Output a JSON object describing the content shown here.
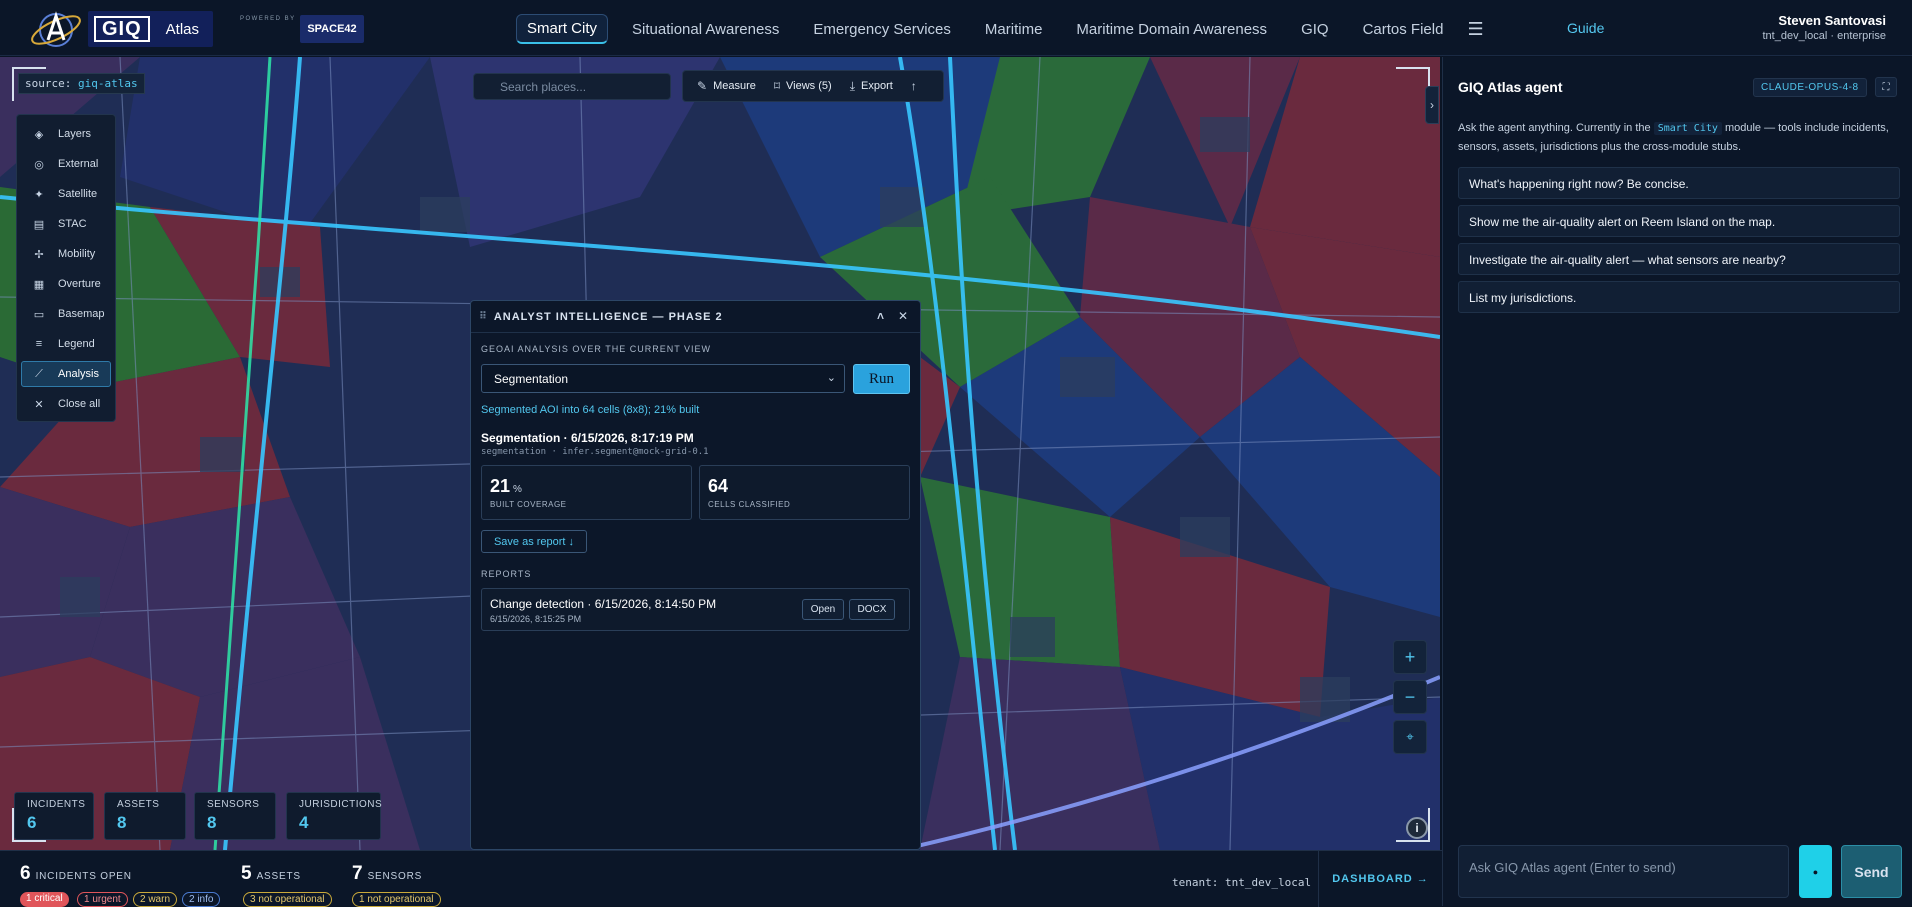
{
  "header": {
    "logo_giq": "GIQ",
    "logo_atlas": "Atlas",
    "powered_by": "POWERED BY",
    "partner": "SPACE42",
    "nav": [
      "Smart City",
      "Situational Awareness",
      "Emergency Services",
      "Maritime",
      "Maritime Domain Awareness",
      "GIQ",
      "Cartos Field"
    ],
    "active_nav": "Smart City",
    "menu_icon": "hamburger-icon",
    "guide": "Guide",
    "user_name": "Steven Santovasi",
    "user_tenant": "tnt_dev_local · enterprise"
  },
  "map": {
    "source_label": "source:",
    "source_value": "giq-atlas",
    "search_placeholder": "Search places...",
    "tools": {
      "measure": "Measure",
      "views": "Views (5)",
      "export": "Export"
    },
    "sidebar": [
      {
        "label": "Layers",
        "icon": "layers-icon"
      },
      {
        "label": "External",
        "icon": "globe-icon"
      },
      {
        "label": "Satellite",
        "icon": "satellite-icon"
      },
      {
        "label": "STAC",
        "icon": "stack-icon"
      },
      {
        "label": "Mobility",
        "icon": "mobility-icon"
      },
      {
        "label": "Overture",
        "icon": "grid-icon"
      },
      {
        "label": "Basemap",
        "icon": "map-icon"
      },
      {
        "label": "Legend",
        "icon": "list-icon"
      },
      {
        "label": "Analysis",
        "icon": "chart-icon"
      },
      {
        "label": "Close all",
        "icon": "close-icon"
      }
    ],
    "active_sidebar": "Analysis",
    "stats": [
      {
        "label": "INCIDENTS",
        "value": "6"
      },
      {
        "label": "ASSETS",
        "value": "8"
      },
      {
        "label": "SENSORS",
        "value": "8"
      },
      {
        "label": "JURISDICTIONS",
        "value": "4"
      }
    ],
    "zoom_in": "+",
    "zoom_out": "−",
    "info": "i"
  },
  "panel": {
    "title": "ANALYST INTELLIGENCE — PHASE 2",
    "subtitle": "GEOAI ANALYSIS OVER THE CURRENT VIEW",
    "select_value": "Segmentation",
    "run": "Run",
    "note": "Segmented AOI into 64 cells (8x8); 21% built",
    "result_title": "Segmentation · 6/15/2026, 8:17:19 PM",
    "result_meta": "segmentation · infer.segment@mock-grid-0.1",
    "kpis": [
      {
        "value": "21",
        "unit": "%",
        "label": "BUILT COVERAGE"
      },
      {
        "value": "64",
        "unit": "",
        "label": "CELLS CLASSIFIED"
      }
    ],
    "save": "Save as report ↓",
    "reports_label": "REPORTS",
    "report": {
      "title": "Change detection · 6/15/2026, 8:14:50 PM",
      "date": "6/15/2026, 8:15:25 PM",
      "open": "Open",
      "docx": "DOCX"
    }
  },
  "agent": {
    "title": "GIQ Atlas agent",
    "model": "CLAUDE-OPUS-4-8",
    "desc_pre": "Ask the agent anything. Currently in the",
    "desc_module": "Smart City",
    "desc_post": "module — tools include incidents, sensors, assets, jurisdictions plus the cross-module stubs.",
    "suggestions": [
      "What's happening right now? Be concise.",
      "Show me the air-quality alert on Reem Island on the map.",
      "Investigate the air-quality alert — what sensors are nearby?",
      "List my jurisdictions."
    ],
    "input_placeholder": "Ask GIQ Atlas agent (Enter to send)",
    "send": "Send"
  },
  "footer": {
    "incidents_num": "6",
    "incidents_label": "INCIDENTS OPEN",
    "assets_num": "5",
    "assets_label": "ASSETS",
    "sensors_num": "7",
    "sensors_label": "SENSORS",
    "pills": {
      "critical": "1 critical",
      "urgent": "1 urgent",
      "warn": "2 warn",
      "info": "2 info",
      "assets_not_op": "3 not operational",
      "sensors_not_op": "1 not operational"
    },
    "tenant": "tenant: tnt_dev_local",
    "dashboard": "DASHBOARD →"
  },
  "colors": {
    "accent": "#52c7ee",
    "panel_bg": "#0c1729",
    "critical": "#e0555a",
    "urgent": "#e0555a",
    "warn": "#c9a93a",
    "info": "#4a7ad0"
  }
}
